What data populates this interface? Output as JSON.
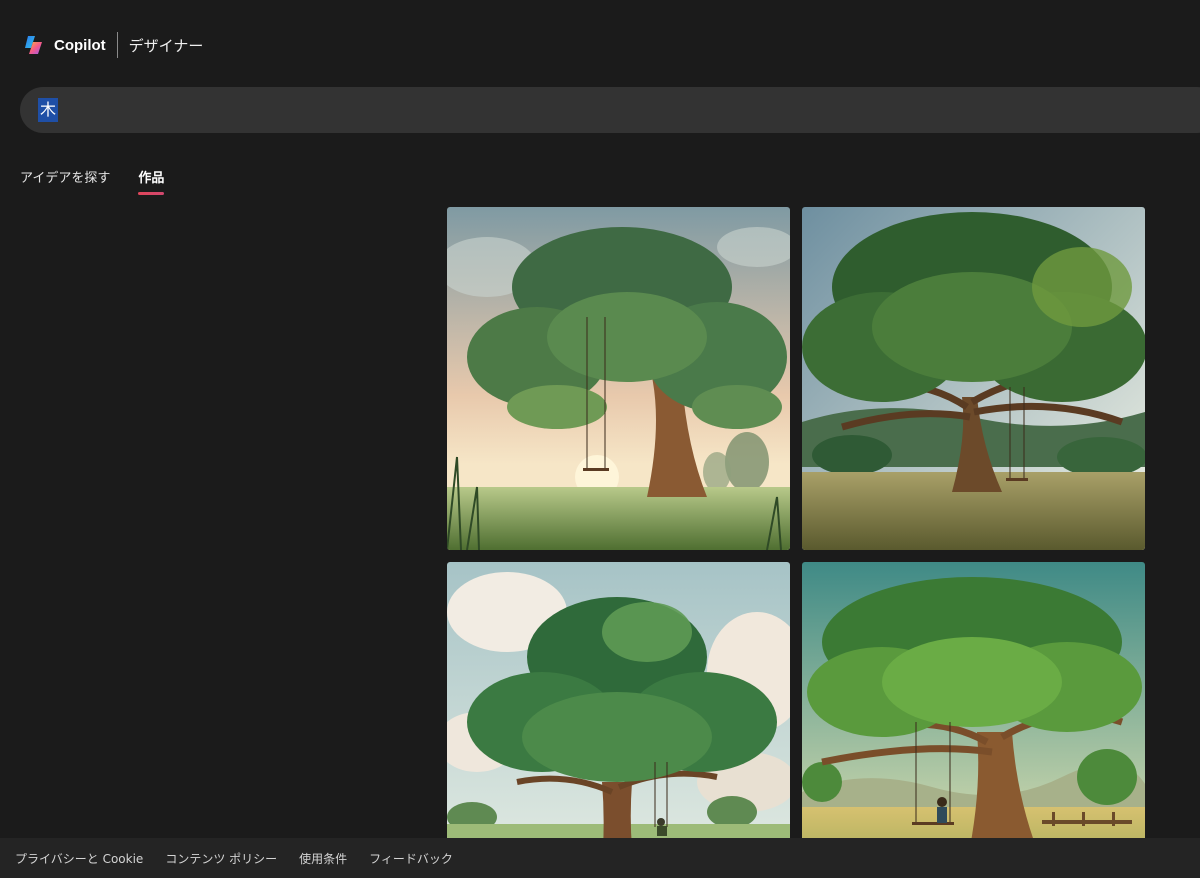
{
  "header": {
    "brand": "Copilot",
    "product": "デザイナー",
    "logo_icon": "copilot-logo-icon"
  },
  "search": {
    "value": "木"
  },
  "tabs": [
    {
      "label": "アイデアを探す",
      "active": false
    },
    {
      "label": "作品",
      "active": true
    }
  ],
  "gallery": {
    "images": [
      {
        "subject": "tree with swing at sunrise"
      },
      {
        "subject": "large oak tree in meadow with swing"
      },
      {
        "subject": "rounded tree with child on swing under clouds"
      },
      {
        "subject": "illustrated tree with child on swing in field"
      }
    ]
  },
  "footer": {
    "links": [
      "プライバシーと Cookie",
      "コンテンツ ポリシー",
      "使用条件",
      "フィードバック"
    ]
  },
  "colors": {
    "background": "#1b1b1b",
    "search_bg": "#333333",
    "footer_bg": "#242424",
    "tab_underline": "#e0465a",
    "selection": "#1f4fa6"
  }
}
